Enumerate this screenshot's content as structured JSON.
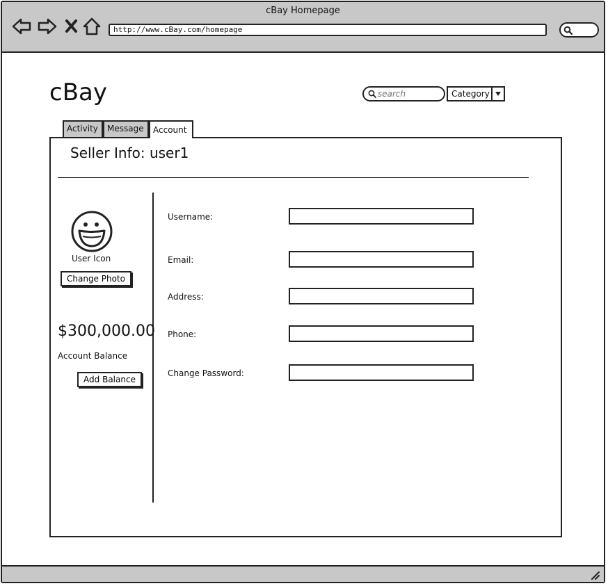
{
  "window": {
    "title": "cBay Homepage"
  },
  "browser": {
    "url": "http://www.cBay.com/homepage"
  },
  "header": {
    "logo": "cBay",
    "search_placeholder": "search",
    "category_label": "Category"
  },
  "tabs": [
    {
      "label": "Activity",
      "active": false
    },
    {
      "label": "Message",
      "active": false
    },
    {
      "label": "Account",
      "active": true
    }
  ],
  "panel": {
    "title": "Seller Info: user1",
    "user_icon_label": "User Icon",
    "change_photo_label": "Change Photo",
    "balance": "$300,000.00",
    "balance_label": "Account Balance",
    "add_balance_label": "Add Balance"
  },
  "form": {
    "fields": [
      {
        "label": "Username:",
        "value": ""
      },
      {
        "label": "Email:",
        "value": ""
      },
      {
        "label": "Address:",
        "value": ""
      },
      {
        "label": "Phone:",
        "value": ""
      },
      {
        "label": "Change Password:",
        "value": ""
      }
    ]
  },
  "icons": {
    "back": "arrow-left-icon",
    "forward": "arrow-right-icon",
    "stop": "close-icon",
    "home": "home-icon",
    "search": "search-icon",
    "dropdown": "caret-down-icon",
    "avatar": "smiley-face-icon",
    "resize": "resize-grip-icon"
  },
  "colors": {
    "chrome": "#c8c8c8",
    "ink": "#222222"
  }
}
